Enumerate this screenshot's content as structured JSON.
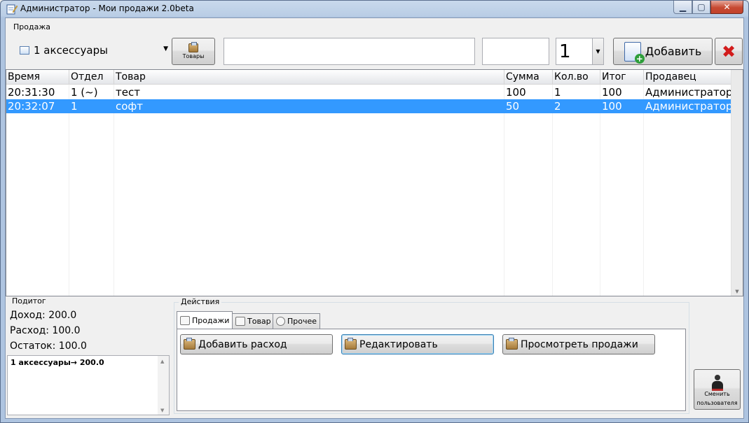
{
  "window": {
    "title": "Администратор - Мои продажи 2.0beta",
    "icons": {
      "app": "notepad-pencil-icon",
      "minimize": "minimize-icon",
      "maximize": "maximize-icon",
      "close": "close-icon"
    }
  },
  "sale_group": {
    "title": "Продажа",
    "department_select": {
      "value": "1 аксессуары",
      "icon": "list-icon"
    },
    "goods_button": {
      "label": "Товары",
      "icon": "box-icon"
    },
    "search_input": {
      "value": ""
    },
    "price_input": {
      "value": ""
    },
    "quantity_select": {
      "value": "1"
    },
    "add_button": {
      "label": "Добавить",
      "icon": "add-document-icon"
    },
    "delete_button": {
      "icon": "red-x-icon",
      "glyph": "✖"
    }
  },
  "sales_table": {
    "columns": [
      "Время",
      "Отдел",
      "Товар",
      "Сумма",
      "Кол.во",
      "Итог",
      "Продавец"
    ],
    "rows": [
      {
        "time": "20:31:30",
        "dept": "1 (~)",
        "item": "тест",
        "sum": "100",
        "qty": "1",
        "total": "100",
        "seller": "Администратор",
        "selected": false
      },
      {
        "time": "20:32:07",
        "dept": "1",
        "item": "софт",
        "sum": "50",
        "qty": "2",
        "total": "100",
        "seller": "Администратор",
        "selected": true
      }
    ]
  },
  "summary_group": {
    "title": "Подитог",
    "income": "Доход: 200.0",
    "expense": "Расход: 100.0",
    "balance": "Остаток: 100.0",
    "breakdown": [
      "1 аксессуары→ 200.0"
    ]
  },
  "actions_group": {
    "title": "Действия",
    "tabs": [
      {
        "label": "Продажи",
        "icon": "edit-icon",
        "active": true
      },
      {
        "label": "Товар",
        "icon": "table-icon",
        "active": false
      },
      {
        "label": "Прочее",
        "icon": "gear-icon",
        "active": false
      }
    ],
    "buttons": {
      "add_expense": "Добавить расход",
      "edit": "Редактировать",
      "view_sales": "Просмотреть продажи"
    }
  },
  "switch_user_button": {
    "label_line1": "Сменить",
    "label_line2": "пользователя",
    "icon": "user-icon"
  }
}
